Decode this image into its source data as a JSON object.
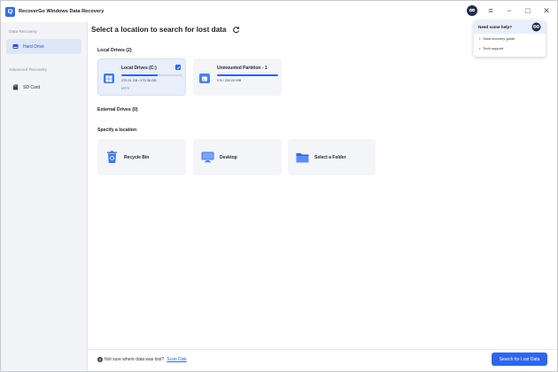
{
  "window": {
    "title": "RecoverGo Windows Data Recovery"
  },
  "window_controls": {
    "mascot_icon": "mascot-help-icon",
    "menu_icon": "≡",
    "minimize_icon": "−",
    "maximize_icon": "□",
    "close_icon": "✕"
  },
  "sidebar": {
    "section_data": "Data Recovery",
    "section_advanced": "Advanced Recovery",
    "items": [
      {
        "label": "Hard Drive",
        "icon": "hard-drive-icon",
        "active": true
      },
      {
        "label": "SD Card",
        "icon": "sd-card-icon",
        "active": false
      }
    ]
  },
  "main": {
    "title": "Select a location to search for lost data",
    "local_drives_heading": "Local Drives (2)",
    "external_drives_heading": "External Drives (0)",
    "specify_location_heading": "Specify a location",
    "drives": [
      {
        "name": "Local Drives (C:)",
        "size": "279.31 GB / 475.38 GB",
        "filesystem": "NTFS",
        "usage": 0.59,
        "selected": true
      },
      {
        "name": "Unmounted Partition - 1",
        "size": "0 B / 200.00 MB",
        "filesystem": "",
        "usage": 1.0,
        "selected": false
      }
    ],
    "locations": [
      {
        "label": "Recycle Bin",
        "icon": "recycle-bin-icon"
      },
      {
        "label": "Desktop",
        "icon": "desktop-icon"
      },
      {
        "label": "Select a Folder",
        "icon": "folder-icon"
      }
    ]
  },
  "bottom": {
    "help_text": "Not sure where data was lost?",
    "scan_disk": "Scan Disk",
    "search_button": "Search for Lost Data"
  },
  "help_popup": {
    "title": "Need some help?",
    "links": [
      "Data recovery guide",
      "Tech support"
    ]
  },
  "colors": {
    "accent": "#2e66ea",
    "sidebar_bg": "#f3f4f8",
    "card_bg": "#f4f5f8"
  }
}
